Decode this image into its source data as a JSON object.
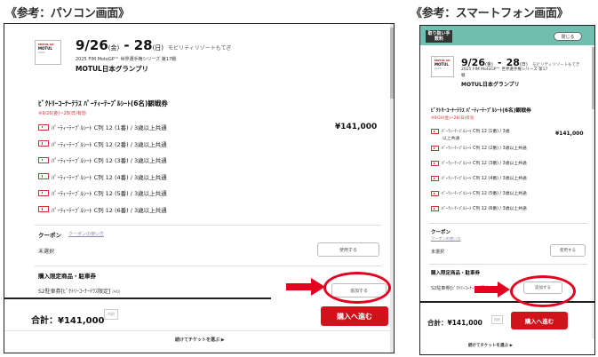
{
  "captions": {
    "pc": "《参考：パソコン画面》",
    "sp": "《参考：スマートフォン画面》"
  },
  "event": {
    "logo_line1": "MOTUL GP",
    "logo_line2": "MOTUL GRAND PRIX OF JAPAN",
    "logo_line3": "2025",
    "date_start": "9/26",
    "dow_start": "(金)",
    "dash": "-",
    "date_end": "28",
    "dow_end": "(日)",
    "venue": "モビリティリゾートもてぎ",
    "series_pc": "2025 FIM MotoGP™ 世界選手権シリーズ 第17戦",
    "series_sp_1": "2025 FIM MotoGP™ 世界選手権シリーズ 第17",
    "series_sp_2": "戦",
    "gp_name": "MOTUL日本グランプリ"
  },
  "seat": {
    "title": "ﾋﾞｸﾄﾘｰｺｰﾅｰﾃﾗｽ ﾊﾟｰﾃｨｰﾃｰﾌﾞﾙｼｰﾄ(6名)観戦券",
    "valid": "※9/26(金)~28(日)有効",
    "price": "¥141,000",
    "rows": [
      "ﾊﾟｰﾃｨｰﾃｰﾌﾞﾙｼｰﾄ C列 12 (1番) / 3歳以上共通",
      "ﾊﾟｰﾃｨｰﾃｰﾌﾞﾙｼｰﾄ C列 12 (2番) / 3歳以上共通",
      "ﾊﾟｰﾃｨｰﾃｰﾌﾞﾙｼｰﾄ C列 12 (3番) / 3歳以上共通",
      "ﾊﾟｰﾃｨｰﾃｰﾌﾞﾙｼｰﾄ C列 12 (4番) / 3歳以上共通",
      "ﾊﾟｰﾃｨｰﾃｰﾌﾞﾙｼｰﾄ C列 12 (5番) / 3歳以上共通",
      "ﾊﾟｰﾃｨｰﾃｰﾌﾞﾙｼｰﾄ C列 12 (6番) / 3歳以上共通"
    ],
    "sp_row1_a": "ﾊﾟｰﾃｨｰﾃｰﾌﾞﾙｼｰﾄ C列 12 (1番) / 3歳",
    "sp_row1_b": "以上共通"
  },
  "coupon": {
    "label": "クーポン",
    "howto": "クーポンの使い方",
    "status": "未選択",
    "use_button": "使用する"
  },
  "limited": {
    "label": "購入限定商品・駐車券",
    "item": "S2駐車券[ﾋﾞｸﾄﾘｰｺｰﾅｰﾃﾗｽ限定]",
    "item_note": "(¥0)",
    "add_button": "追加する"
  },
  "footer": {
    "total": "合計：¥141,000",
    "tax": "内訳",
    "purchase": "購入へ進む",
    "continue": "続けてチケットを選ぶ ▶"
  },
  "sp_header": {
    "badge": "取り扱い手数料",
    "close": "閉じる"
  },
  "colors": {
    "accent_red": "#d0121b",
    "highlight_red": "#e4001f",
    "sp_header_green": "#6fbfb0"
  }
}
